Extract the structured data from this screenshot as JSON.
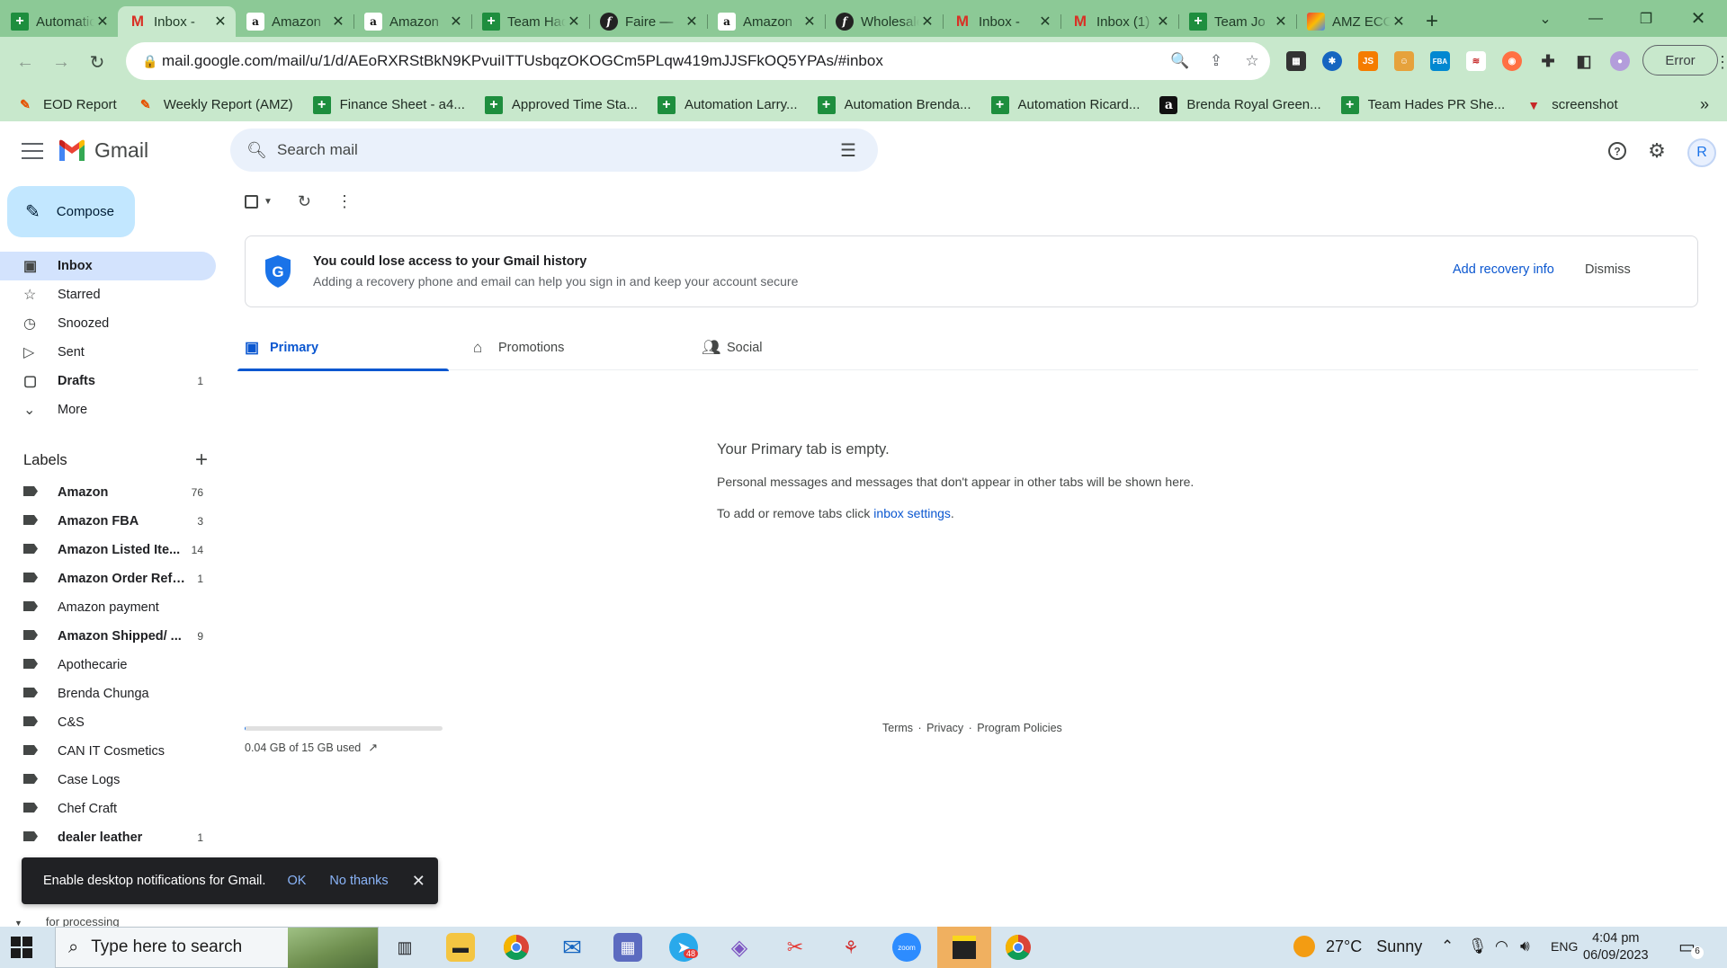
{
  "browser": {
    "tabs": [
      {
        "title": "Automation",
        "icon": "sheets-icon",
        "active": false
      },
      {
        "title": "Inbox - ",
        "icon": "gmail-icon",
        "active": true
      },
      {
        "title": "Amazon",
        "icon": "amazon-icon",
        "active": false
      },
      {
        "title": "Amazon",
        "icon": "amazon-icon",
        "active": false
      },
      {
        "title": "Team Hades",
        "icon": "sheets-icon",
        "active": false
      },
      {
        "title": "Faire — ",
        "icon": "faire-icon",
        "active": false
      },
      {
        "title": "Amazon",
        "icon": "amazon-icon",
        "active": false
      },
      {
        "title": "Wholesale",
        "icon": "faire-icon",
        "active": false
      },
      {
        "title": "Inbox - ",
        "icon": "gmail-icon",
        "active": false
      },
      {
        "title": "Inbox (1)",
        "icon": "gmail-icon",
        "active": false
      },
      {
        "title": "Team Jo",
        "icon": "sheets-icon",
        "active": false
      },
      {
        "title": "AMZ ECO",
        "icon": "amz-eco-icon",
        "active": false
      }
    ],
    "url": "mail.google.com/mail/u/1/d/AEoRXRStBkN9KPvuiITTUsbqzOKOGCm5PLqw419mJJSFkOQ5YPAs/#inbox",
    "profile_button": "Error",
    "bookmarks": [
      {
        "label": "EOD Report",
        "icon": "multicolor-pen-icon"
      },
      {
        "label": "Weekly Report (AMZ)",
        "icon": "multicolor-pen-icon"
      },
      {
        "label": "Finance Sheet - a4...",
        "icon": "sheets-icon"
      },
      {
        "label": "Approved Time Sta...",
        "icon": "sheets-icon"
      },
      {
        "label": "Automation Larry...",
        "icon": "sheets-icon"
      },
      {
        "label": "Automation Brenda...",
        "icon": "sheets-icon"
      },
      {
        "label": "Automation Ricard...",
        "icon": "sheets-icon"
      },
      {
        "label": "Brenda Royal Green...",
        "icon": "amazon-icon"
      },
      {
        "label": "Team Hades PR She...",
        "icon": "sheets-icon"
      },
      {
        "label": "screenshot",
        "icon": "red-funnel-icon"
      }
    ],
    "bookmarks_more": "»"
  },
  "gmail": {
    "app_name": "Gmail",
    "search_placeholder": "Search mail",
    "avatar_letter": "R",
    "compose_label": "Compose",
    "nav": [
      {
        "label": "Inbox",
        "icon": "inbox-icon",
        "count": "",
        "active": true,
        "bold": true
      },
      {
        "label": "Starred",
        "icon": "star-icon",
        "count": "",
        "active": false,
        "bold": false
      },
      {
        "label": "Snoozed",
        "icon": "clock-icon",
        "count": "",
        "active": false,
        "bold": false
      },
      {
        "label": "Sent",
        "icon": "send-icon",
        "count": "",
        "active": false,
        "bold": false
      },
      {
        "label": "Drafts",
        "icon": "draft-icon",
        "count": "1",
        "active": false,
        "bold": true
      },
      {
        "label": "More",
        "icon": "chevron-down-icon",
        "count": "",
        "active": false,
        "bold": false
      }
    ],
    "labels_header": "Labels",
    "labels": [
      {
        "label": "Amazon",
        "count": "76",
        "bold": true
      },
      {
        "label": "Amazon FBA",
        "count": "3",
        "bold": true
      },
      {
        "label": "Amazon Listed Ite...",
        "count": "14",
        "bold": true
      },
      {
        "label": "Amazon Order Refu...",
        "count": "1",
        "bold": true
      },
      {
        "label": "Amazon payment",
        "count": "",
        "bold": false
      },
      {
        "label": "Amazon Shipped/ ...",
        "count": "9",
        "bold": true
      },
      {
        "label": "Apothecarie",
        "count": "",
        "bold": false
      },
      {
        "label": "Brenda Chunga",
        "count": "",
        "bold": false
      },
      {
        "label": "C&S",
        "count": "",
        "bold": false
      },
      {
        "label": "CAN IT Cosmetics",
        "count": "",
        "bold": false
      },
      {
        "label": "Case Logs",
        "count": "",
        "bold": false
      },
      {
        "label": "Chef Craft",
        "count": "",
        "bold": false
      },
      {
        "label": "dealer leather",
        "count": "1",
        "bold": true
      }
    ],
    "partially_visible_label": "for processing",
    "banner": {
      "title": "You could lose access to your Gmail history",
      "subtitle": "Adding a recovery phone and email can help you sign in and keep your account secure",
      "action": "Add recovery info",
      "dismiss": "Dismiss"
    },
    "category_tabs": [
      {
        "label": "Primary",
        "icon": "inbox-icon",
        "active": true
      },
      {
        "label": "Promotions",
        "icon": "tag-icon",
        "active": false
      },
      {
        "label": "Social",
        "icon": "people-icon",
        "active": false
      }
    ],
    "empty_state": {
      "title": "Your Primary tab is empty.",
      "subtitle": "Personal messages and messages that don't appear in other tabs will be shown here.",
      "settings_prefix": "To add or remove tabs click ",
      "settings_link": "inbox settings",
      "settings_suffix": "."
    },
    "storage": {
      "text": "0.04 GB of 15 GB used",
      "used_fraction": 0.003
    },
    "footer": {
      "terms": "Terms",
      "privacy": "Privacy",
      "policies": "Program Policies",
      "separator": "·"
    },
    "toast": {
      "message": "Enable desktop notifications for Gmail.",
      "ok": "OK",
      "no_thanks": "No thanks"
    }
  },
  "taskbar": {
    "search_placeholder": "Type here to search",
    "telegram_badge": "48",
    "weather_temp": "27°C",
    "weather_desc": "Sunny",
    "language": "ENG",
    "time": "4:04 pm",
    "date": "06/09/2023",
    "notification_count": "6"
  },
  "colors": {
    "tabstrip": "#8cc996",
    "toolbar": "#c8e8cc",
    "accent_blue": "#0b57d0",
    "compose_bg": "#c2e7ff",
    "nav_active": "#d3e3fd",
    "search_bg": "#eaf1fb"
  }
}
